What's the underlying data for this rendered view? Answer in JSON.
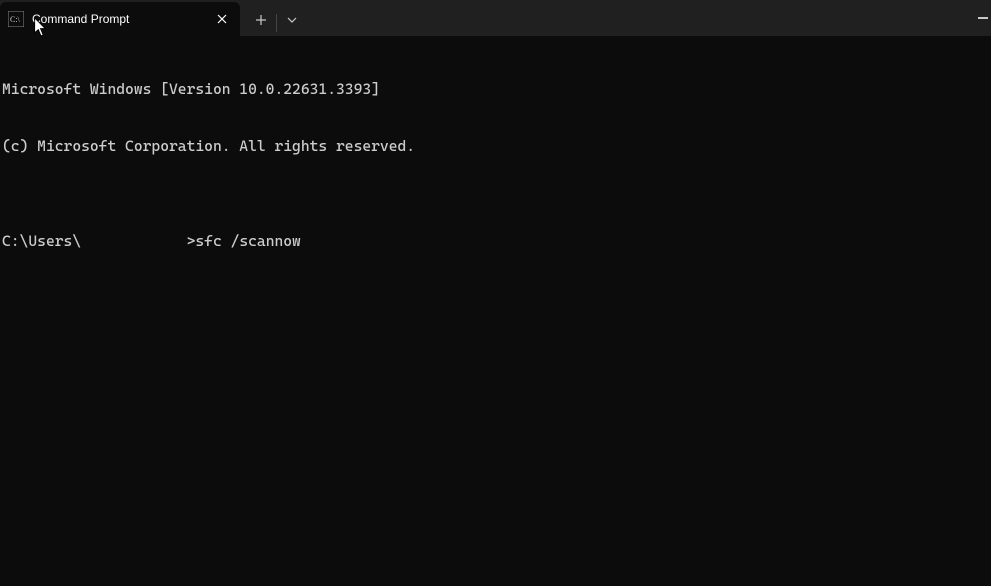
{
  "tab": {
    "title": "Command Prompt",
    "close_label": "✕"
  },
  "tabbar": {
    "new_tab_label": "+",
    "dropdown_label": "⌄"
  },
  "window": {
    "minimize_label": "−"
  },
  "terminal": {
    "line1": "Microsoft Windows [Version 10.0.22631.3393]",
    "line2": "(c) Microsoft Corporation. All rights reserved.",
    "blank": "",
    "prompt_path": "C:\\Users\\",
    "prompt_gap": "            ",
    "prompt_symbol": ">",
    "command": "sfc /scannow"
  }
}
